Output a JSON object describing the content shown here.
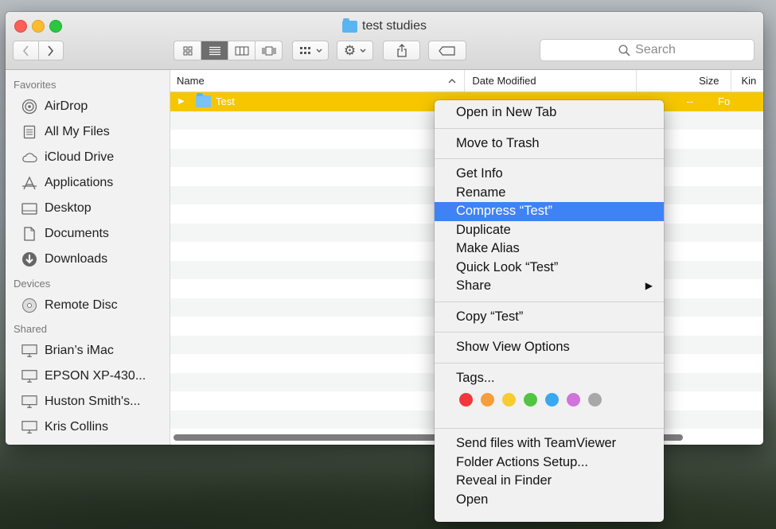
{
  "window": {
    "title": "test studies"
  },
  "toolbar": {
    "back_icon": "chevron-left",
    "forward_icon": "chevron-right",
    "view_icons": [
      "icon-view",
      "list-view",
      "column-view",
      "coverflow-view"
    ],
    "search_placeholder": "Search"
  },
  "sidebar": {
    "sections": [
      {
        "title": "Favorites",
        "items": [
          {
            "label": "AirDrop",
            "icon": "airdrop-icon"
          },
          {
            "label": "All My Files",
            "icon": "all-files-icon"
          },
          {
            "label": "iCloud Drive",
            "icon": "cloud-icon"
          },
          {
            "label": "Applications",
            "icon": "applications-icon"
          },
          {
            "label": "Desktop",
            "icon": "desktop-icon"
          },
          {
            "label": "Documents",
            "icon": "documents-icon"
          },
          {
            "label": "Downloads",
            "icon": "downloads-icon"
          }
        ]
      },
      {
        "title": "Devices",
        "items": [
          {
            "label": "Remote Disc",
            "icon": "disc-icon"
          }
        ]
      },
      {
        "title": "Shared",
        "items": [
          {
            "label": "Brian’s iMac",
            "icon": "monitor-icon"
          },
          {
            "label": "EPSON XP-430...",
            "icon": "monitor-icon"
          },
          {
            "label": "Huston Smith's...",
            "icon": "monitor-icon"
          },
          {
            "label": "Kris Collins",
            "icon": "monitor-icon"
          }
        ]
      }
    ]
  },
  "columns": {
    "name": "Name",
    "date": "Date Modified",
    "size": "Size",
    "kind": "Kin"
  },
  "files": [
    {
      "name": "Test",
      "size": "--",
      "kind": "Fo"
    }
  ],
  "context_menu": {
    "groups": [
      [
        "Open in New Tab"
      ],
      [
        "Move to Trash"
      ],
      [
        "Get Info",
        "Rename",
        "Compress “Test”",
        "Duplicate",
        "Make Alias",
        "Quick Look “Test”",
        "Share"
      ],
      [
        "Copy “Test”"
      ],
      [
        "Show View Options"
      ],
      [
        "Tags..."
      ],
      [
        "Send files with TeamViewer",
        "Folder Actions Setup...",
        "Reveal in Finder",
        "Open"
      ]
    ],
    "highlighted": "Compress “Test”",
    "submenu_items": [
      "Share"
    ],
    "tag_colors": [
      "#f0383a",
      "#f79d3a",
      "#f7cb31",
      "#52c443",
      "#3aa8ef",
      "#d073db",
      "#a8a8a8"
    ]
  }
}
